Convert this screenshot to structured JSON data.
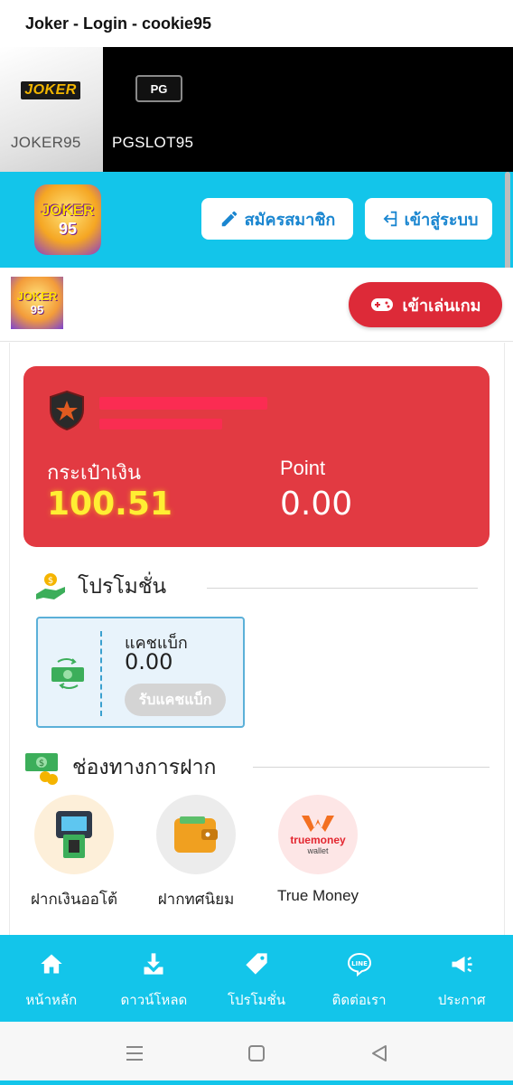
{
  "window": {
    "title": "Joker - Login - cookie95"
  },
  "game_tabs": [
    {
      "label": "JOKER95",
      "logo_text": "JOKER",
      "active": true
    },
    {
      "label": "PGSLOT95",
      "logo_text": "PG",
      "active": false
    }
  ],
  "header": {
    "logo_top": "JOKER",
    "logo_bottom": "95",
    "register_label": "สมัครสมาชิก",
    "login_label": "เข้าสู่ระบบ"
  },
  "subbar": {
    "logo_top": "JOKER",
    "logo_bottom": "95",
    "play_label": "เข้าเล่นเกม"
  },
  "wallet": {
    "wallet_label": "กระเป๋าเงิน",
    "wallet_value": "100.51",
    "point_label": "Point",
    "point_value": "0.00"
  },
  "promotions": {
    "title": "โปรโมชั่น",
    "cashback_label": "แคชแบ็ก",
    "cashback_value": "0.00",
    "cashback_button": "รับแคชแบ็ก"
  },
  "deposit": {
    "title": "ช่องทางการฝาก",
    "methods": [
      {
        "label": "ฝากเงินออโต้",
        "icon": "atm-icon"
      },
      {
        "label": "ฝากทศนิยม",
        "icon": "wallet-icon"
      },
      {
        "label": "True Money",
        "icon": "truemoney-icon",
        "logo_line1": "truemoney",
        "logo_line2": "wallet"
      }
    ]
  },
  "bottom_nav": [
    {
      "label": "หน้าหลัก",
      "icon": "home-icon"
    },
    {
      "label": "ดาวน์โหลด",
      "icon": "download-icon"
    },
    {
      "label": "โปรโมชั่น",
      "icon": "tag-icon"
    },
    {
      "label": "ติดต่อเรา",
      "icon": "line-chat-icon",
      "icon_text": "LINE"
    },
    {
      "label": "ประกาศ",
      "icon": "megaphone-icon"
    }
  ],
  "colors": {
    "accent_cyan": "#13c5ea",
    "wallet_red": "#e23a42",
    "play_red": "#dd2a38",
    "wallet_value_yellow": "#ffee33"
  }
}
